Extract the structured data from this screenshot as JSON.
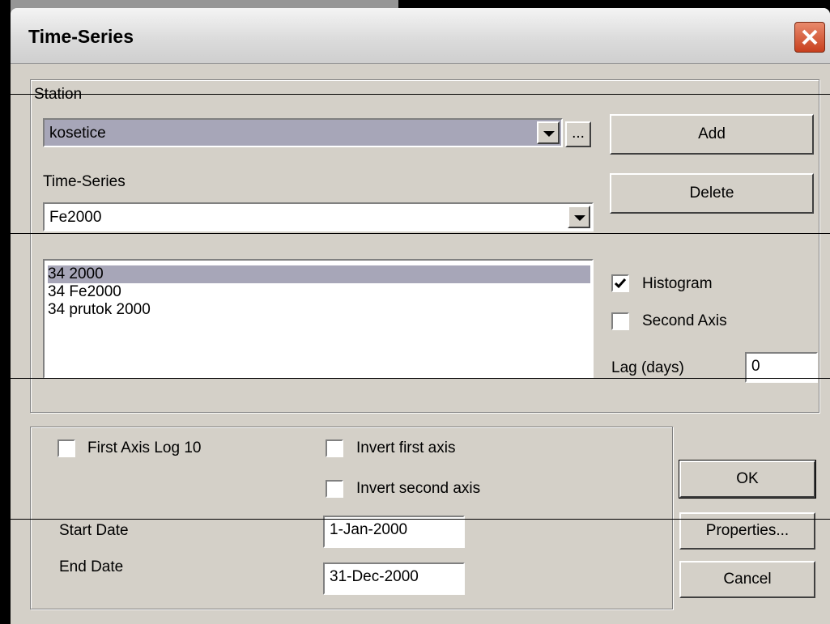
{
  "window": {
    "title": "Time-Series"
  },
  "station": {
    "label": "Station",
    "value": "kosetice",
    "browse_label": "..."
  },
  "timeseries": {
    "label": "Time-Series",
    "value": "Fe2000"
  },
  "list": {
    "items": [
      "34 2000",
      "34 Fe2000",
      "34 prutok 2000"
    ],
    "selected_index": 0
  },
  "buttons": {
    "add": "Add",
    "delete": "Delete",
    "ok": "OK",
    "properties": "Properties...",
    "cancel": "Cancel"
  },
  "options": {
    "histogram": {
      "label": "Histogram",
      "checked": true
    },
    "second_axis": {
      "label": "Second Axis",
      "checked": false
    },
    "lag_label": "Lag (days)",
    "lag_value": "0"
  },
  "axis": {
    "first_log": {
      "label": "First Axis Log 10",
      "checked": false
    },
    "invert_first": {
      "label": "Invert first axis",
      "checked": false
    },
    "invert_second": {
      "label": "Invert second axis",
      "checked": false
    }
  },
  "dates": {
    "start_label": "Start Date",
    "start_value": "1-Jan-2000",
    "end_label": "End Date",
    "end_value": "31-Dec-2000"
  },
  "colors": {
    "selection": "#a7a6b8",
    "face": "#d4d0c8",
    "close_button": "#c8401e"
  }
}
